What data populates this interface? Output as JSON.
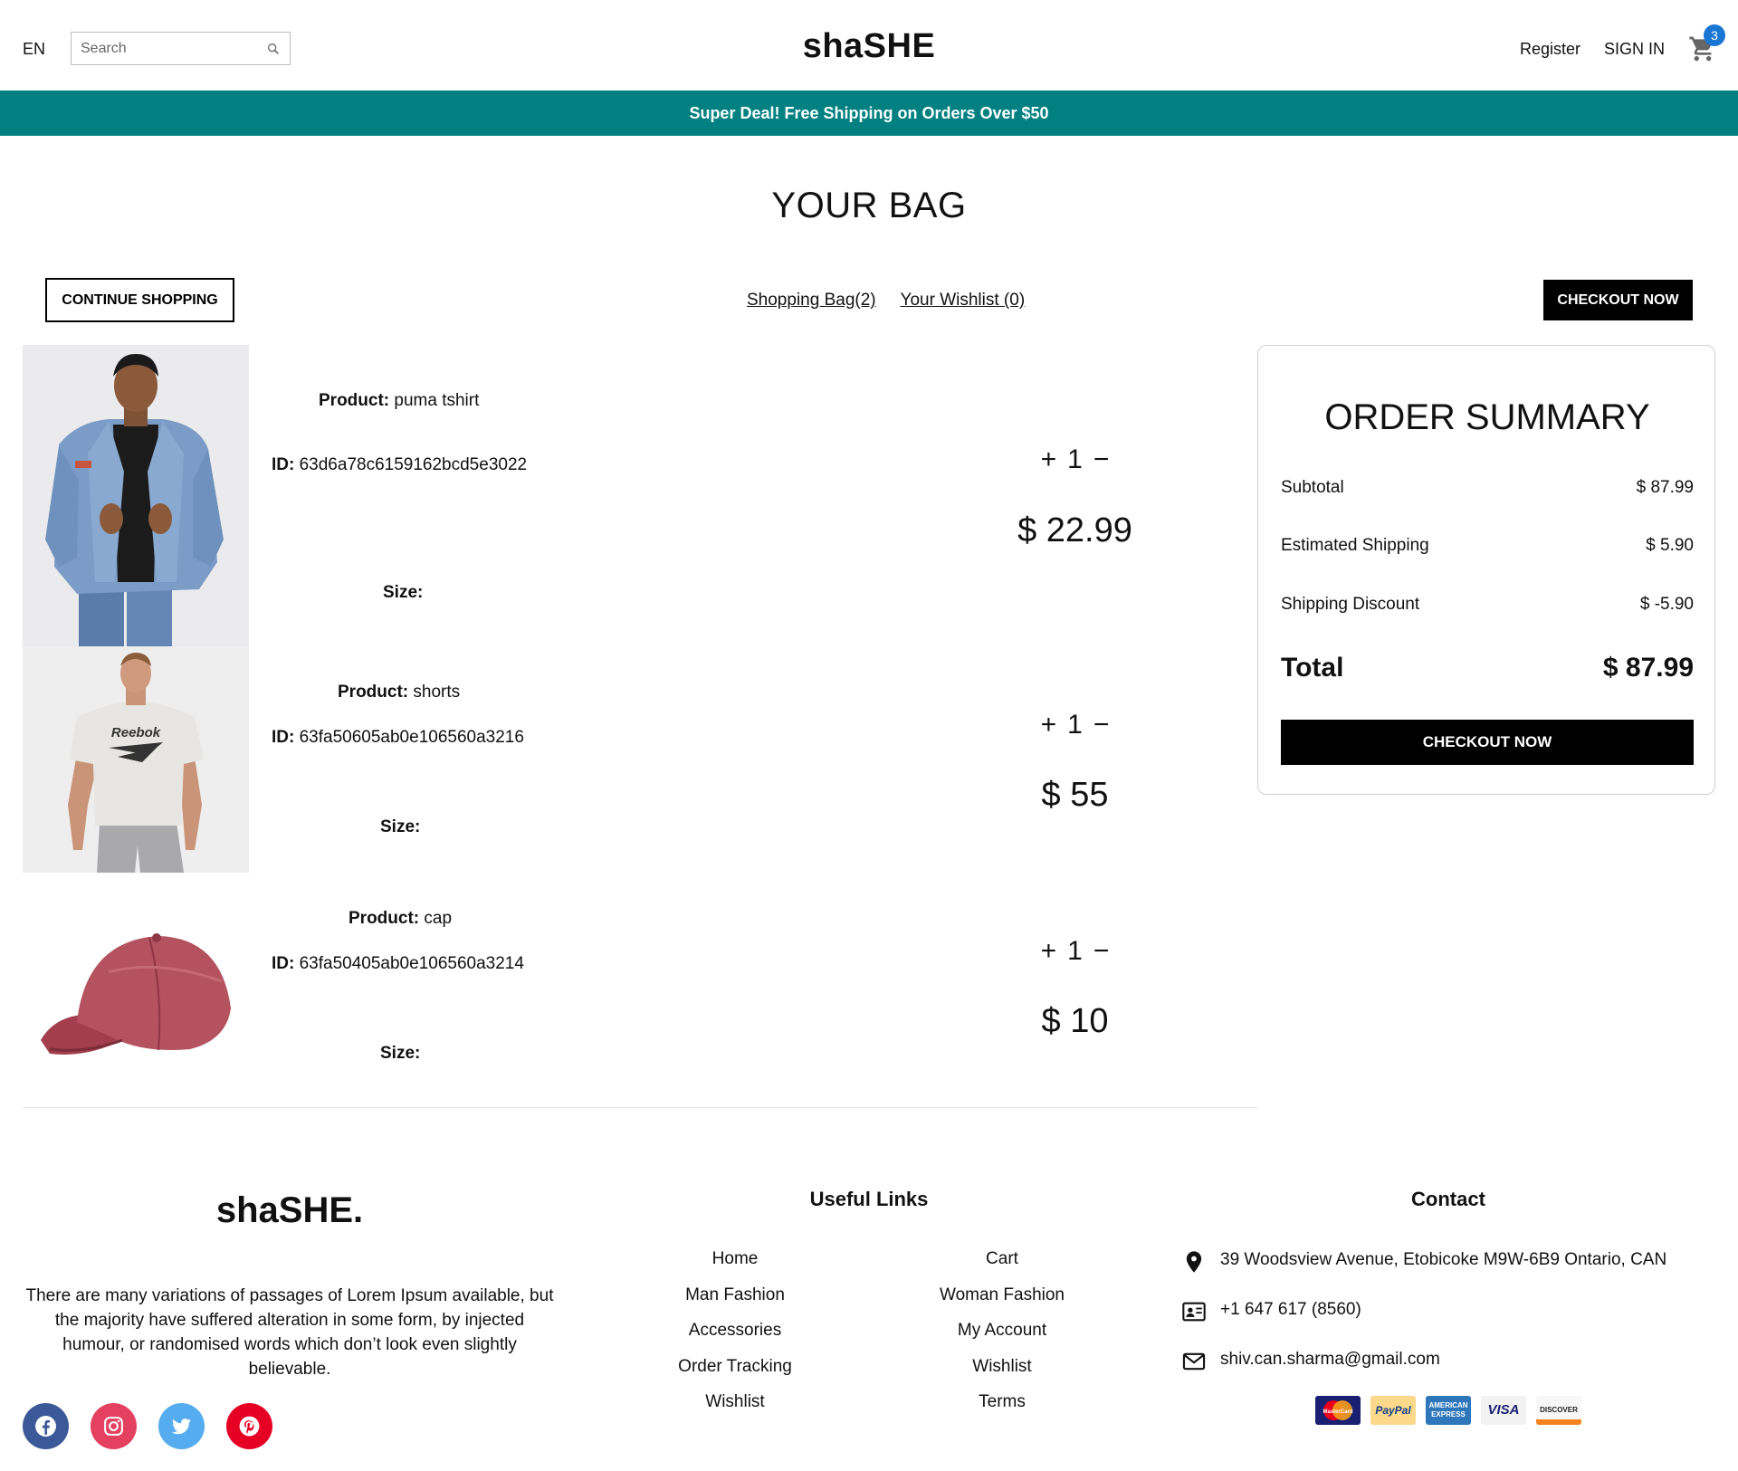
{
  "nav": {
    "lang": "EN",
    "search_placeholder": "Search",
    "logo": "shaSHE",
    "register": "Register",
    "signin": "SIGN IN",
    "cart_count": "3"
  },
  "announcement": "Super Deal! Free Shipping on Orders Over $50",
  "bag": {
    "title": "YOUR BAG",
    "continue": "CONTINUE SHOPPING",
    "shopping_bag_link": "Shopping Bag(2)",
    "wishlist_link": "Your Wishlist (0)",
    "checkout": "CHECKOUT NOW"
  },
  "labels": {
    "product": "Product:",
    "id": "ID:",
    "size": "Size:"
  },
  "products": [
    {
      "name": "puma tshirt",
      "id": "63d6a78c6159162bcd5e3022",
      "qty": "1",
      "price": "$ 22.99",
      "image": "man-denim-jacket"
    },
    {
      "name": "shorts",
      "id": "63fa50605ab0e106560a3216",
      "qty": "1",
      "price": "$ 55",
      "image": "man-reebok-tshirt"
    },
    {
      "name": "cap",
      "id": "63fa50405ab0e106560a3214",
      "qty": "1",
      "price": "$ 10",
      "image": "red-cap"
    }
  ],
  "summary": {
    "title": "ORDER SUMMARY",
    "subtotal_label": "Subtotal",
    "subtotal": "$ 87.99",
    "shipping_label": "Estimated Shipping",
    "shipping": "$ 5.90",
    "discount_label": "Shipping Discount",
    "discount": "$ -5.90",
    "total_label": "Total",
    "total": "$ 87.99",
    "checkout": "CHECKOUT NOW"
  },
  "footer": {
    "logo": "shaSHE.",
    "description": "There are many variations of passages of Lorem Ipsum available, but the majority have suffered alteration in some form, by injected humour, or randomised words which don’t look even slightly believable.",
    "links_title": "Useful Links",
    "links_left": [
      "Home",
      "Man Fashion",
      "Accessories",
      "Order Tracking",
      "Wishlist"
    ],
    "links_right": [
      "Cart",
      "Woman Fashion",
      "My Account",
      "Wishlist",
      "Terms"
    ],
    "contact_title": "Contact",
    "address": "39 Woodsview Avenue, Etobicoke M9W-6B9 Ontario, CAN",
    "phone": "+1 647 617 (8560)",
    "email": "shiv.can.sharma@gmail.com",
    "payment_methods": [
      "MasterCard",
      "PayPal",
      "AMERICAN EXPRESS",
      "VISA",
      "DISCOVER"
    ]
  },
  "colors": {
    "announcement_bg": "#008080",
    "badge": "#1976d2",
    "facebook": "#3b5998",
    "instagram": "#e4405f",
    "twitter": "#55acee",
    "pinterest": "#e60023"
  },
  "icons": {
    "search": "search-icon",
    "cart": "cart-icon",
    "qty_plus": "plus-icon",
    "qty_minus": "minus-icon",
    "location": "location-pin-icon",
    "phone": "contact-card-icon",
    "email": "mail-icon"
  }
}
